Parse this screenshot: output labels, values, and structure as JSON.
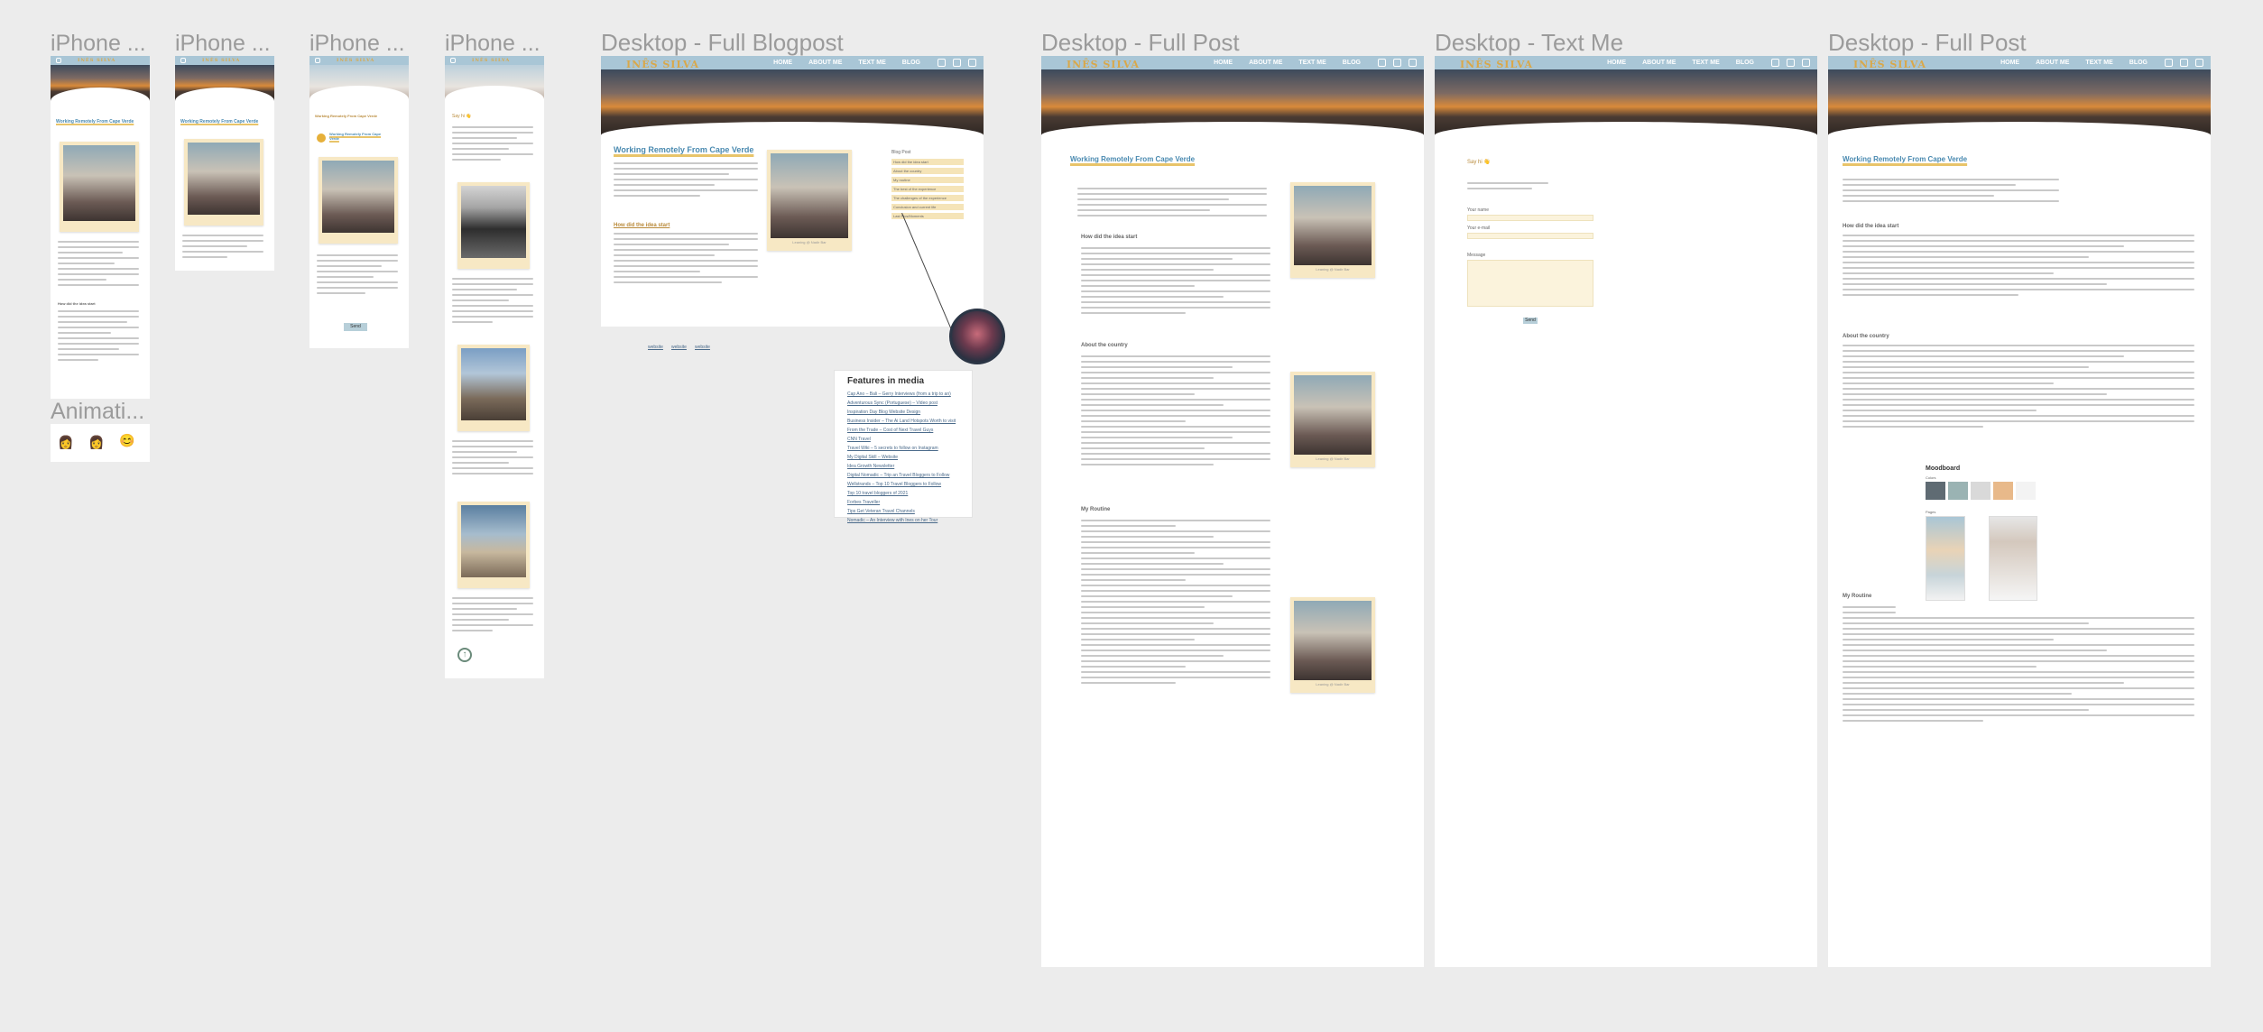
{
  "frames": {
    "iphone1": {
      "title": "iPhone ..."
    },
    "iphone2": {
      "title": "iPhone ..."
    },
    "iphone3": {
      "title": "iPhone ..."
    },
    "iphone4": {
      "title": "iPhone ..."
    },
    "desktop_blog": {
      "title": "Desktop - Full Blogpost"
    },
    "desktop_post": {
      "title": "Desktop - Full Post"
    },
    "desktop_text": {
      "title": "Desktop - Text Me"
    },
    "desktop_post2": {
      "title": "Desktop - Full Post"
    },
    "animations": {
      "title": "Animati..."
    }
  },
  "site": {
    "brand": "INÊS SILVA",
    "nav": [
      "HOME",
      "ABOUT ME",
      "TEXT ME",
      "BLOG"
    ],
    "post_title": "Working Remotely From Cape Verde",
    "section_idea": "How did the idea start",
    "section_country": "About the country",
    "section_routine": "My Routine",
    "photo_caption": "Leaning @ Nadir Bar",
    "text_me_greeting": "Say hi 👋",
    "form_name": "Your name",
    "form_email": "Your e-mail",
    "form_message": "Message",
    "send": "Send",
    "moodboard": "Moodboard",
    "colors_label": "Colors",
    "pages_label": "Pages",
    "me_label": "Me",
    "blog_link": "Working Remotely From Cape Verde"
  },
  "features": {
    "title": "Features in media",
    "items": [
      "Cap Ano – Bali – Gerry Interviews (from a trip to an)",
      "Adventurous Sync (Portuguese) – Video post",
      "Inspiration Day Blog Website Design",
      "Business Insider – The Ai Land Hotspots Worth to visit",
      "From the Trade – Cost of Next Travel Guys",
      "CNN Travel",
      "Travel Wiki – 5 secrets to follow on Instagram",
      "My Digital Skill – Website",
      "Idea Growth Newsletter",
      "Digital Nomadic – Trip an Travel Bloggers to Follow",
      "Wellstrands – Top 10 Travel Bloggers to Follow",
      "Top 10 travel bloggers of 2021",
      "Forbes Traveller",
      "Tips Get Veteran Travel Channels",
      "Nomadic – An Interview with Ines on her Tour"
    ]
  },
  "sidebar_links": [
    "Blog Post",
    "How did the idea start",
    "About the country",
    "My routine",
    "The best of the experience",
    "The challenges of the experience",
    "Conclusion and current life",
    "Last Pics/Moments"
  ],
  "footer_links": [
    "website",
    "website",
    "website"
  ],
  "moodboard_colors": [
    "#5f6b73",
    "#9ab3b3",
    "#d9d9d9",
    "#e8b98a",
    "#f3f3f3"
  ],
  "moodboard_color_labels": [
    "#5F6B73",
    "#9AB3B3",
    "#D9D9D9",
    "#E8B98A",
    "#F3F3F3"
  ]
}
